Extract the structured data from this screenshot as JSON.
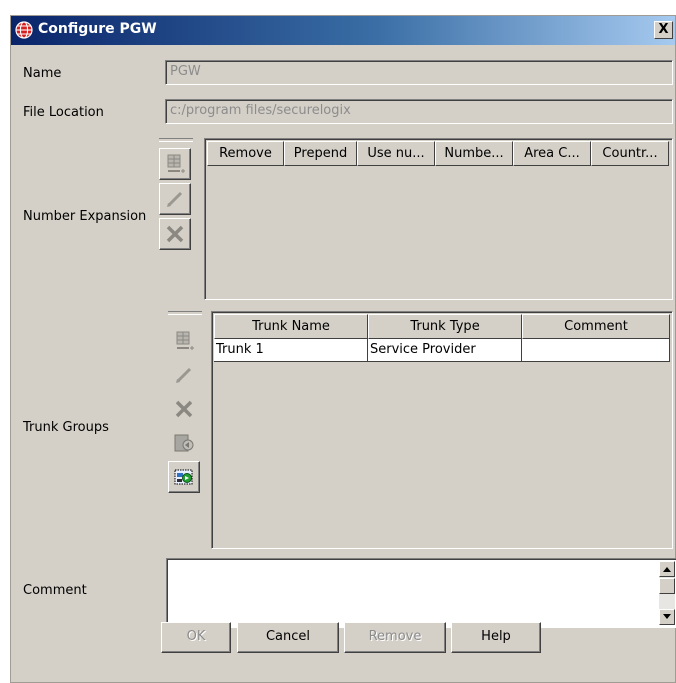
{
  "window": {
    "title": "Configure PGW",
    "close_label": "X"
  },
  "fields": {
    "name": {
      "label": "Name",
      "value": "PGW"
    },
    "file_location": {
      "label": "File Location",
      "value": "c:/program files/securelogix"
    },
    "comment": {
      "label": "Comment",
      "value": ""
    }
  },
  "number_expansion": {
    "label": "Number Expansion",
    "columns": [
      "Remove",
      "Prepend",
      "Use nu...",
      "Numbe...",
      "Area C...",
      "Countr..."
    ],
    "rows": []
  },
  "trunk_groups": {
    "label": "Trunk Groups",
    "columns": [
      "Trunk Name",
      "Trunk Type",
      "Comment"
    ],
    "rows": [
      [
        "Trunk 1",
        "Service Provider",
        ""
      ]
    ]
  },
  "buttons": {
    "ok": "OK",
    "cancel": "Cancel",
    "remove": "Remove",
    "help": "Help"
  },
  "icons": {
    "title": "globe-icon",
    "add_row": "add-row-icon",
    "edit": "pencil-icon",
    "delete": "delete-x-icon",
    "import": "import-icon",
    "export": "export-icon"
  }
}
